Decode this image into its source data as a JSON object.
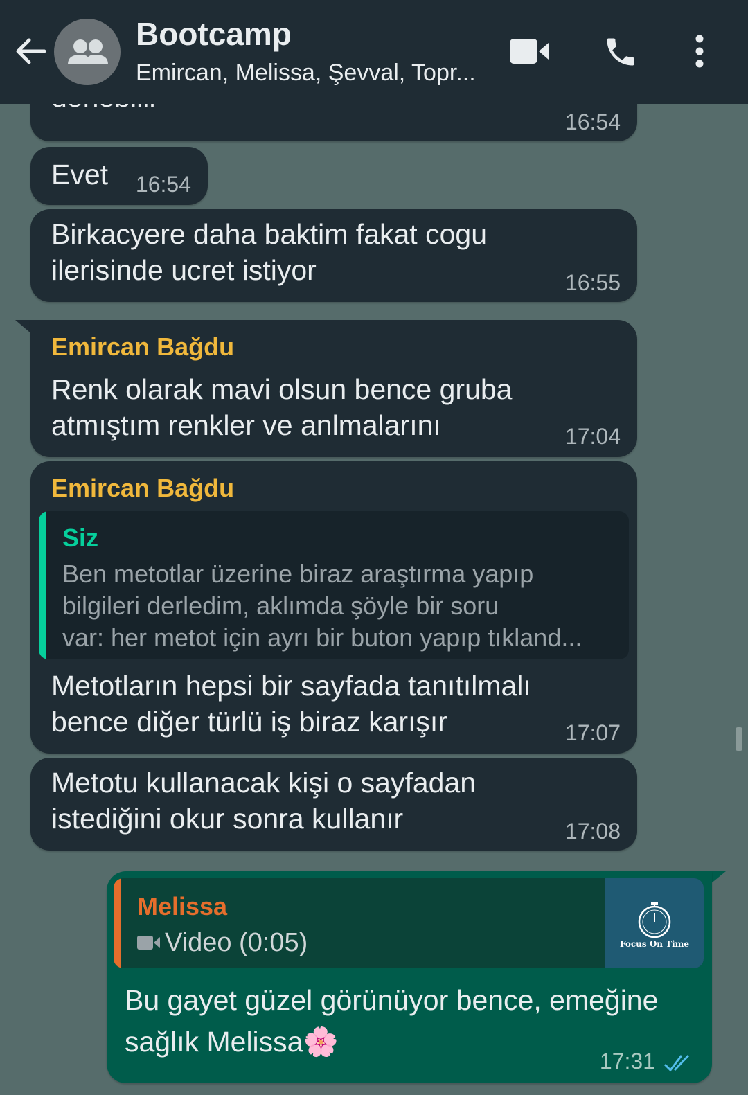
{
  "header": {
    "title": "Bootcamp",
    "subtitle": "Emircan, Melissa, Şevval, Topr..."
  },
  "icons": {
    "back": "arrow-back-icon",
    "avatar": "group-avatar-icon",
    "video": "video-call-icon",
    "call": "phone-call-icon",
    "menu": "more-vertical-icon",
    "read": "double-check-icon",
    "video_small": "video-camera-icon"
  },
  "colors": {
    "header_bg": "#1f2c34",
    "chat_bg": "#566c6b",
    "incoming_bubble": "#1f2c34",
    "outgoing_bubble": "#005c4b",
    "sender_name": "#f0b83c",
    "quote_self": "#06cf9c",
    "quote_melissa": "#e56e2c",
    "read_ticks": "#53bdeb"
  },
  "messages": [
    {
      "text": "donebilir",
      "time": "16:54"
    },
    {
      "text": "Evet",
      "time": "16:54"
    },
    {
      "lines": [
        "Birkacyere daha baktim fakat cogu",
        "ilerisinde ucret istiyor"
      ],
      "time": "16:55"
    },
    {
      "sender": "Emircan Bağdu",
      "lines": [
        "Renk olarak mavi olsun bence gruba",
        "atmıştım renkler ve anlmalarını"
      ],
      "time": "17:04"
    },
    {
      "sender": "Emircan Bağdu",
      "quote": {
        "author": "Siz",
        "lines": [
          "Ben metotlar üzerine biraz araştırma yapıp",
          "bilgileri derledim, aklımda şöyle bir soru",
          "var: her metot için ayrı bir buton yapıp tıkland..."
        ]
      },
      "lines": [
        "Metotların hepsi bir sayfada tanıtılmalı",
        "bence diğer türlü iş biraz karışır"
      ],
      "time": "17:07"
    },
    {
      "lines": [
        "Metotu kullanacak kişi o sayfadan",
        "istediğini okur sonra kullanır"
      ],
      "time": "17:08"
    },
    {
      "outgoing": true,
      "quote": {
        "author": "Melissa",
        "media": "Video (0:05)",
        "thumb_text": "Focus On Time"
      },
      "lines": [
        "Bu gayet güzel görünüyor bence, emeğine",
        "sağlık Melissa"
      ],
      "emoji": "🌸",
      "time": "17:31"
    }
  ]
}
